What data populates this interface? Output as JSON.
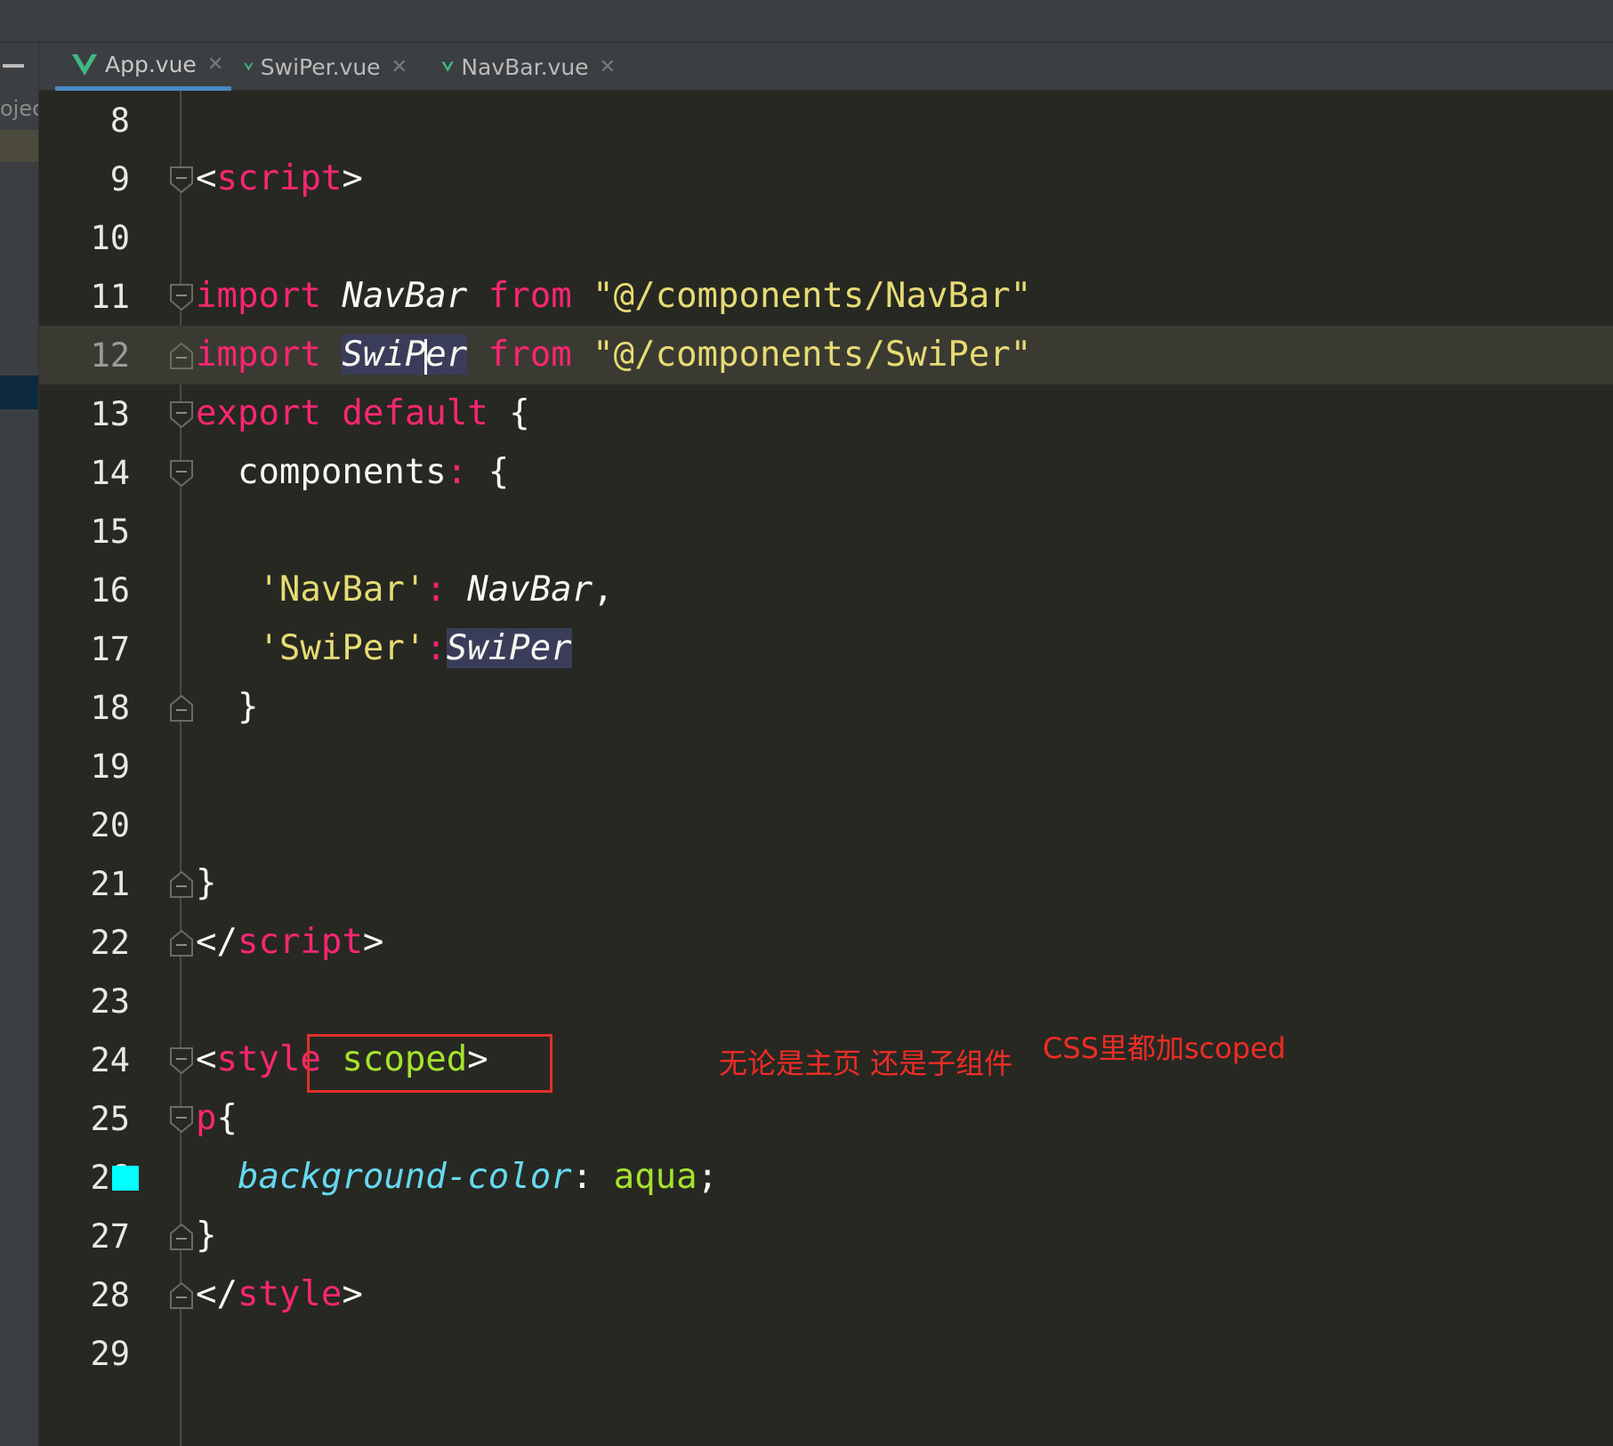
{
  "tabs": [
    {
      "label": "App.vue",
      "icon": "vue-icon",
      "active": true
    },
    {
      "label": "SwiPer.vue",
      "icon": "vue-icon",
      "active": false
    },
    {
      "label": "NavBar.vue",
      "icon": "vue-icon",
      "active": false
    }
  ],
  "project_panel_label": "ojec",
  "editor": {
    "current_line": 12,
    "lines": [
      {
        "n": "8"
      },
      {
        "n": "9"
      },
      {
        "n": "10"
      },
      {
        "n": "11"
      },
      {
        "n": "12"
      },
      {
        "n": "13"
      },
      {
        "n": "14"
      },
      {
        "n": "15"
      },
      {
        "n": "16"
      },
      {
        "n": "17"
      },
      {
        "n": "18"
      },
      {
        "n": "19"
      },
      {
        "n": "20"
      },
      {
        "n": "21"
      },
      {
        "n": "22"
      },
      {
        "n": "23"
      },
      {
        "n": "24"
      },
      {
        "n": "25"
      },
      {
        "n": "26"
      },
      {
        "n": "27"
      },
      {
        "n": "28"
      },
      {
        "n": "29"
      }
    ],
    "code": {
      "l9_open": "<",
      "l9_tag": "script",
      "l9_close": ">",
      "l11_kw": "import",
      "l11_name": "NavBar",
      "l11_from": "from",
      "l11_path": "\"@/components/NavBar\"",
      "l12_kw": "import",
      "l12_name_a": "SwiP",
      "l12_name_b": "er",
      "l12_from": "from",
      "l12_path": "\"@/components/SwiPer\"",
      "l13_export": "export",
      "l13_default": "default",
      "l13_brace": "{",
      "l14_key": "components",
      "l14_colon": ":",
      "l14_brace": "{",
      "l16_key": "'NavBar'",
      "l16_colon": ":",
      "l16_val": "NavBar",
      "l16_comma": ",",
      "l17_key": "'SwiPer'",
      "l17_colon": ":",
      "l17_val": "SwiPer",
      "l18_brace": "}",
      "l21_brace": "}",
      "l22_open": "</",
      "l22_tag": "script",
      "l22_close": ">",
      "l24_open": "<",
      "l24_tag": "style",
      "l24_attr": "scoped",
      "l24_close": ">",
      "l25_sel": "p",
      "l25_brace": "{",
      "l26_prop": "background-color",
      "l26_colon": ":",
      "l26_val": "aqua",
      "l26_semi": ";",
      "l27_brace": "}",
      "l28_open": "</",
      "l28_tag": "style",
      "l28_close": ">"
    },
    "color_swatch": "#00ffff"
  },
  "annotation": {
    "text_1": "无论是主页  还是子组件",
    "text_2": "CSS里都加scoped",
    "color": "#ee2d26"
  }
}
